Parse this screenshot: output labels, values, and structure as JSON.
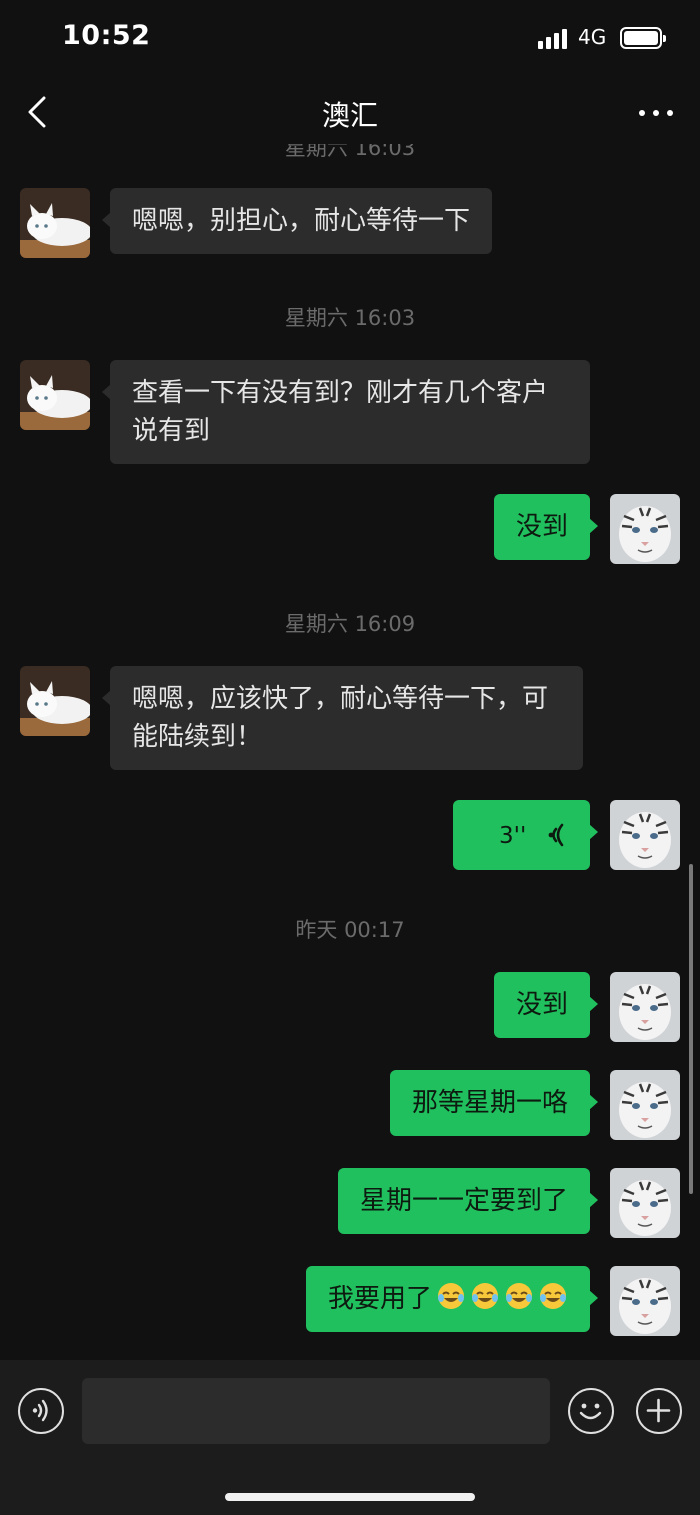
{
  "status_bar": {
    "time": "10:52",
    "network": "4G"
  },
  "header": {
    "title": "澳汇"
  },
  "messages": [
    {
      "type": "time",
      "text": "星期六 16:03"
    },
    {
      "type": "text",
      "from": "contact",
      "text": "嗯嗯，别担心，耐心等待一下"
    },
    {
      "type": "time",
      "text": "星期六 16:03"
    },
    {
      "type": "text",
      "from": "contact",
      "text": "查看一下有没有到？刚才有几个客户说有到"
    },
    {
      "type": "text",
      "from": "me",
      "text": "没到"
    },
    {
      "type": "time",
      "text": "星期六 16:09"
    },
    {
      "type": "text",
      "from": "contact",
      "text": "嗯嗯，应该快了，耐心等待一下，可能陆续到！"
    },
    {
      "type": "voice",
      "from": "me",
      "duration": "3''"
    },
    {
      "type": "time",
      "text": "昨天 00:17"
    },
    {
      "type": "text",
      "from": "me",
      "text": "没到"
    },
    {
      "type": "text",
      "from": "me",
      "text": "那等星期一咯"
    },
    {
      "type": "text",
      "from": "me",
      "text": "星期一一定要到了"
    },
    {
      "type": "text",
      "from": "me",
      "text": "我要用了",
      "emoji": [
        "rolling-laughing-emoji",
        "rolling-laughing-emoji",
        "rolling-laughing-emoji",
        "rolling-laughing-emoji"
      ]
    }
  ],
  "icons": {
    "back": "chevron-left-icon",
    "more": "more-dots-icon",
    "voice_input": "voice-wave-icon",
    "emoji": "smiley-icon",
    "plus": "plus-icon"
  },
  "colors": {
    "outgoing_bubble": "#21c05e",
    "incoming_bubble": "#2c2c2c",
    "background": "#111111"
  }
}
